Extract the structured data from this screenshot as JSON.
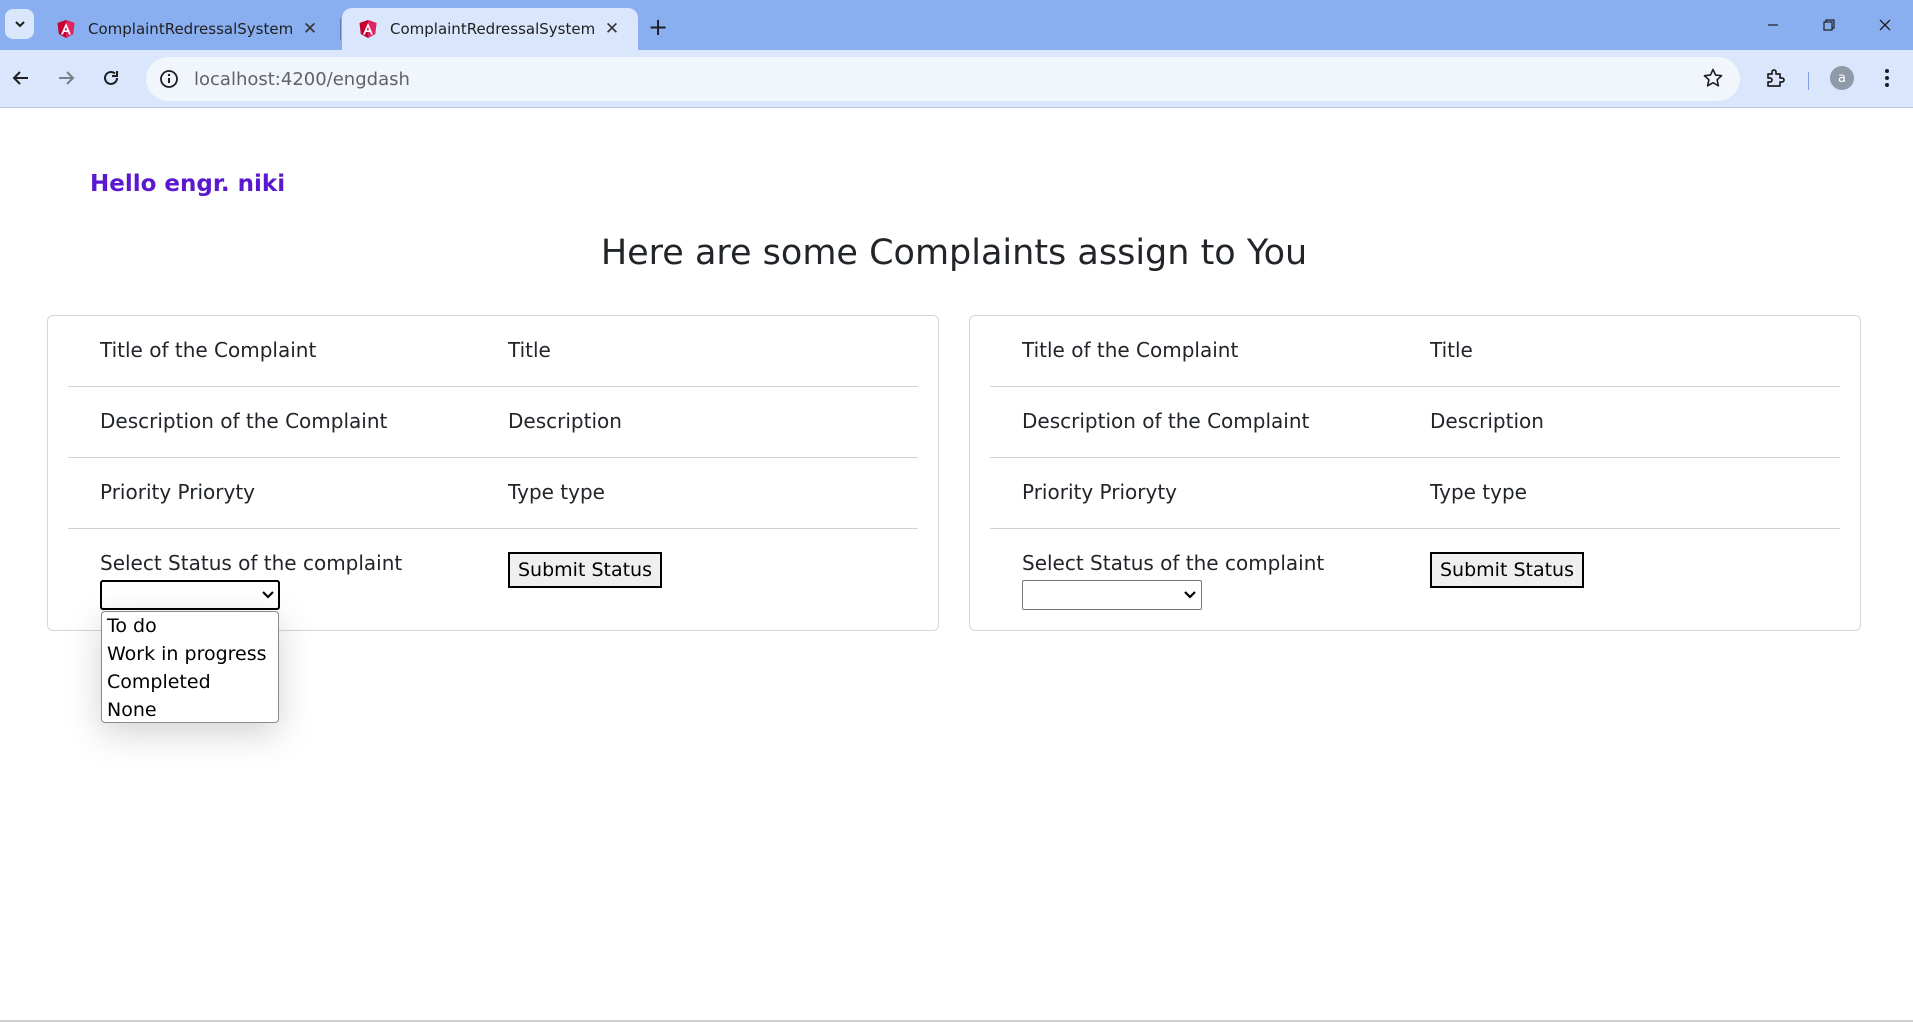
{
  "browser": {
    "tabs": [
      {
        "title": "ComplaintRedressalSystem",
        "active": false
      },
      {
        "title": "ComplaintRedressalSystem",
        "active": true
      }
    ],
    "url": "localhost:4200/engdash",
    "profile_initial": "a"
  },
  "page": {
    "greeting": "Hello engr. niki",
    "heading": "Here are some Complaints assign to You",
    "cards": [
      {
        "title_label": "Title of the Complaint",
        "title_value": "Title",
        "description_label": "Description of the Complaint",
        "description_value": "Description",
        "priority_text": "Priority Prioryty",
        "type_text": "Type type",
        "status_label": "Select Status of the complaint",
        "submit_label": "Submit Status"
      },
      {
        "title_label": "Title of the Complaint",
        "title_value": "Title",
        "description_label": "Description of the Complaint",
        "description_value": "Description",
        "priority_text": "Priority Prioryty",
        "type_text": "Type type",
        "status_label": "Select Status of the complaint",
        "submit_label": "Submit Status"
      }
    ],
    "status_options": [
      "To do",
      "Work in progress",
      "Completed",
      "None"
    ]
  },
  "colors": {
    "greeting": "#5b18d1",
    "tabstrip": "#8aaff0",
    "toolbar": "#d9e6fb"
  }
}
